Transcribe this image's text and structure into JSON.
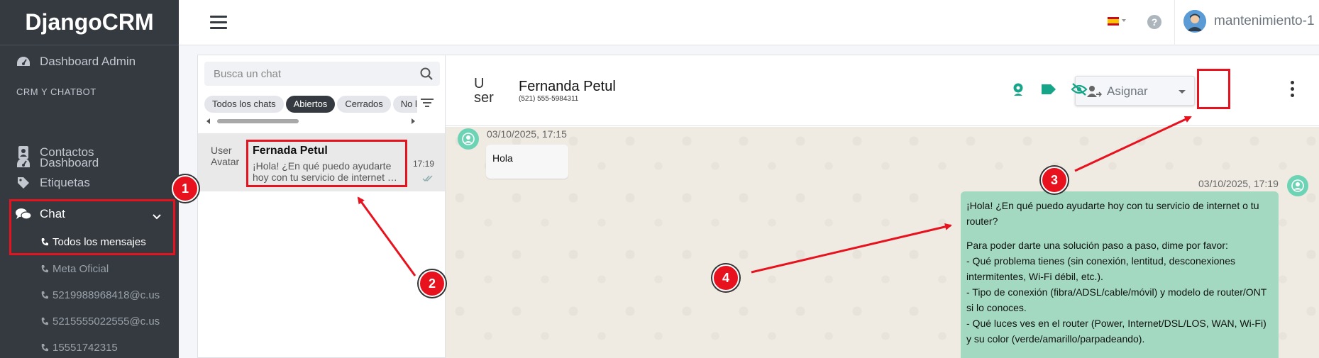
{
  "brand": "DjangoCRM",
  "sidebar": {
    "dashboard_admin": "Dashboard Admin",
    "section_header": "CRM Y CHATBOT",
    "dashboard": "Dashboard",
    "contactos": "Contactos",
    "etiquetas": "Etiquetas",
    "chat": "Chat",
    "sub_items": [
      "Todos los mensajes",
      "Meta Oficial",
      "5219988968418@c.us",
      "5215555022555@c.us",
      "15551742315"
    ]
  },
  "topbar": {
    "help": "?",
    "user_name": "mantenimiento-1"
  },
  "chat_list": {
    "search_placeholder": "Busca un chat",
    "filters": [
      "Todos los chats",
      "Abiertos",
      "Cerrados",
      "No leídos"
    ],
    "active_filter": "Abiertos",
    "conversation": {
      "avatar_alt_1": "User",
      "avatar_alt_2": "Avatar",
      "name": "Fernada Petul",
      "preview_line1": "¡Hola! ¿En qué puedo ayudarte",
      "preview_line2": "hoy con tu servicio de internet o tu router?",
      "time": "17:19"
    }
  },
  "chat_header": {
    "avatar_alt_1": "U",
    "avatar_alt_2": "ser",
    "name": "Fernanda Petul",
    "phone": "(521) 555-5984311",
    "assign_label": "Asignar"
  },
  "messages": {
    "incoming_time": "03/10/2025, 17:15",
    "incoming_text": "Hola",
    "outgoing_time": "03/10/2025, 17:19",
    "outgoing_lines": [
      "¡Hola! ¿En qué puedo ayudarte hoy con tu servicio de internet o tu",
      "router?",
      "",
      "Para poder darte una solución paso a paso, dime por favor:",
      "- Qué problema tienes (sin conexión, lentitud, desconexiones",
      "intermitentes, Wi-Fi débil, etc.).",
      "- Tipo de conexión (fibra/ADSL/cable/móvil) y modelo de router/ONT",
      "si lo conoces.",
      "- Qué luces ves en el router (Power, Internet/DSL/LOS, WAN, Wi-Fi)",
      "y su color (verde/amarillo/parpadeando)."
    ]
  },
  "annotations": [
    "1",
    "2",
    "3",
    "4"
  ],
  "colors": {
    "sidebar_bg": "#343a40",
    "accent_green": "#17a589",
    "annotation_red": "#e8121f",
    "outgoing_bubble": "#a3d9c1"
  }
}
